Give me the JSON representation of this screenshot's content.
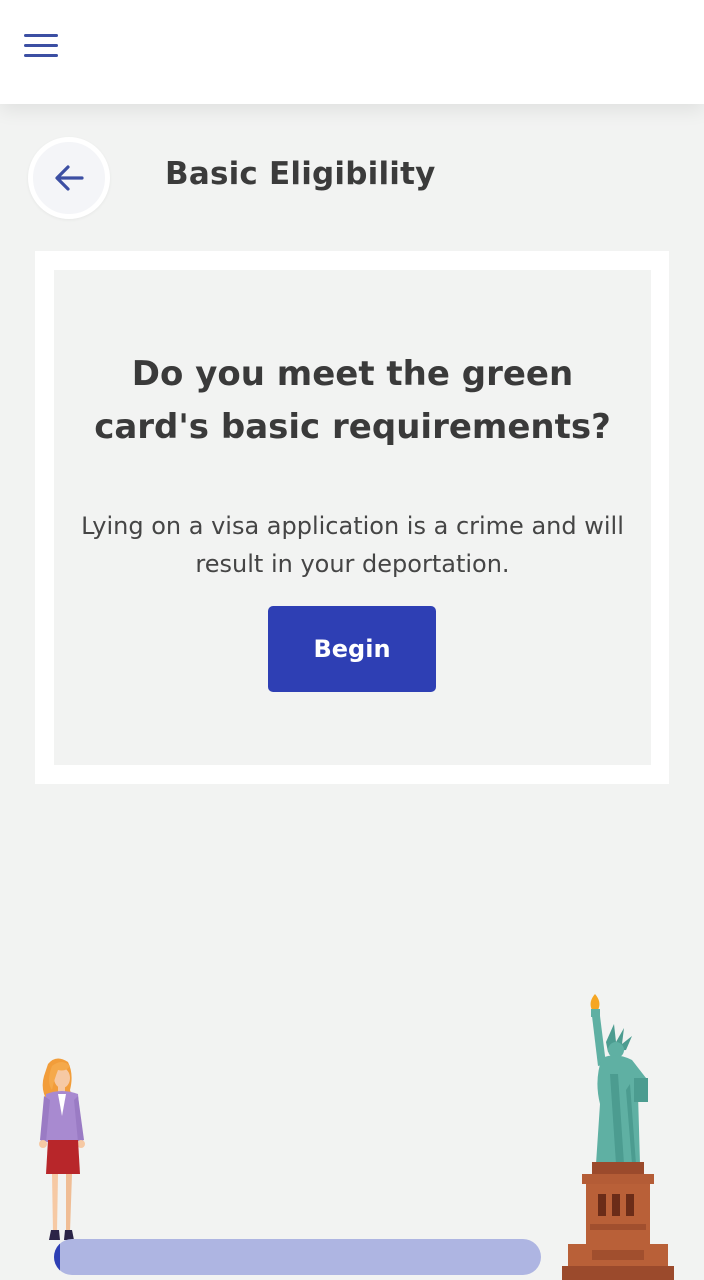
{
  "header": {
    "menu_icon": "hamburger-menu-icon"
  },
  "page": {
    "back_icon": "arrow-left-icon",
    "title": "Basic Eligibility"
  },
  "card": {
    "question": "Do you meet the green card's basic requirements?",
    "warning": "Lying on a visa application is a crime and will result in your deportation.",
    "begin_label": "Begin"
  },
  "illustrations": {
    "woman": "woman-illustration",
    "liberty": "statue-of-liberty-illustration"
  },
  "progress": {
    "fraction": 0.01
  },
  "colors": {
    "accent": "#2e3fb4",
    "accent_light": "#aeb5e2",
    "menu_icon": "#3c4fa3",
    "background": "#f2f3f2",
    "card": "#ffffff"
  }
}
